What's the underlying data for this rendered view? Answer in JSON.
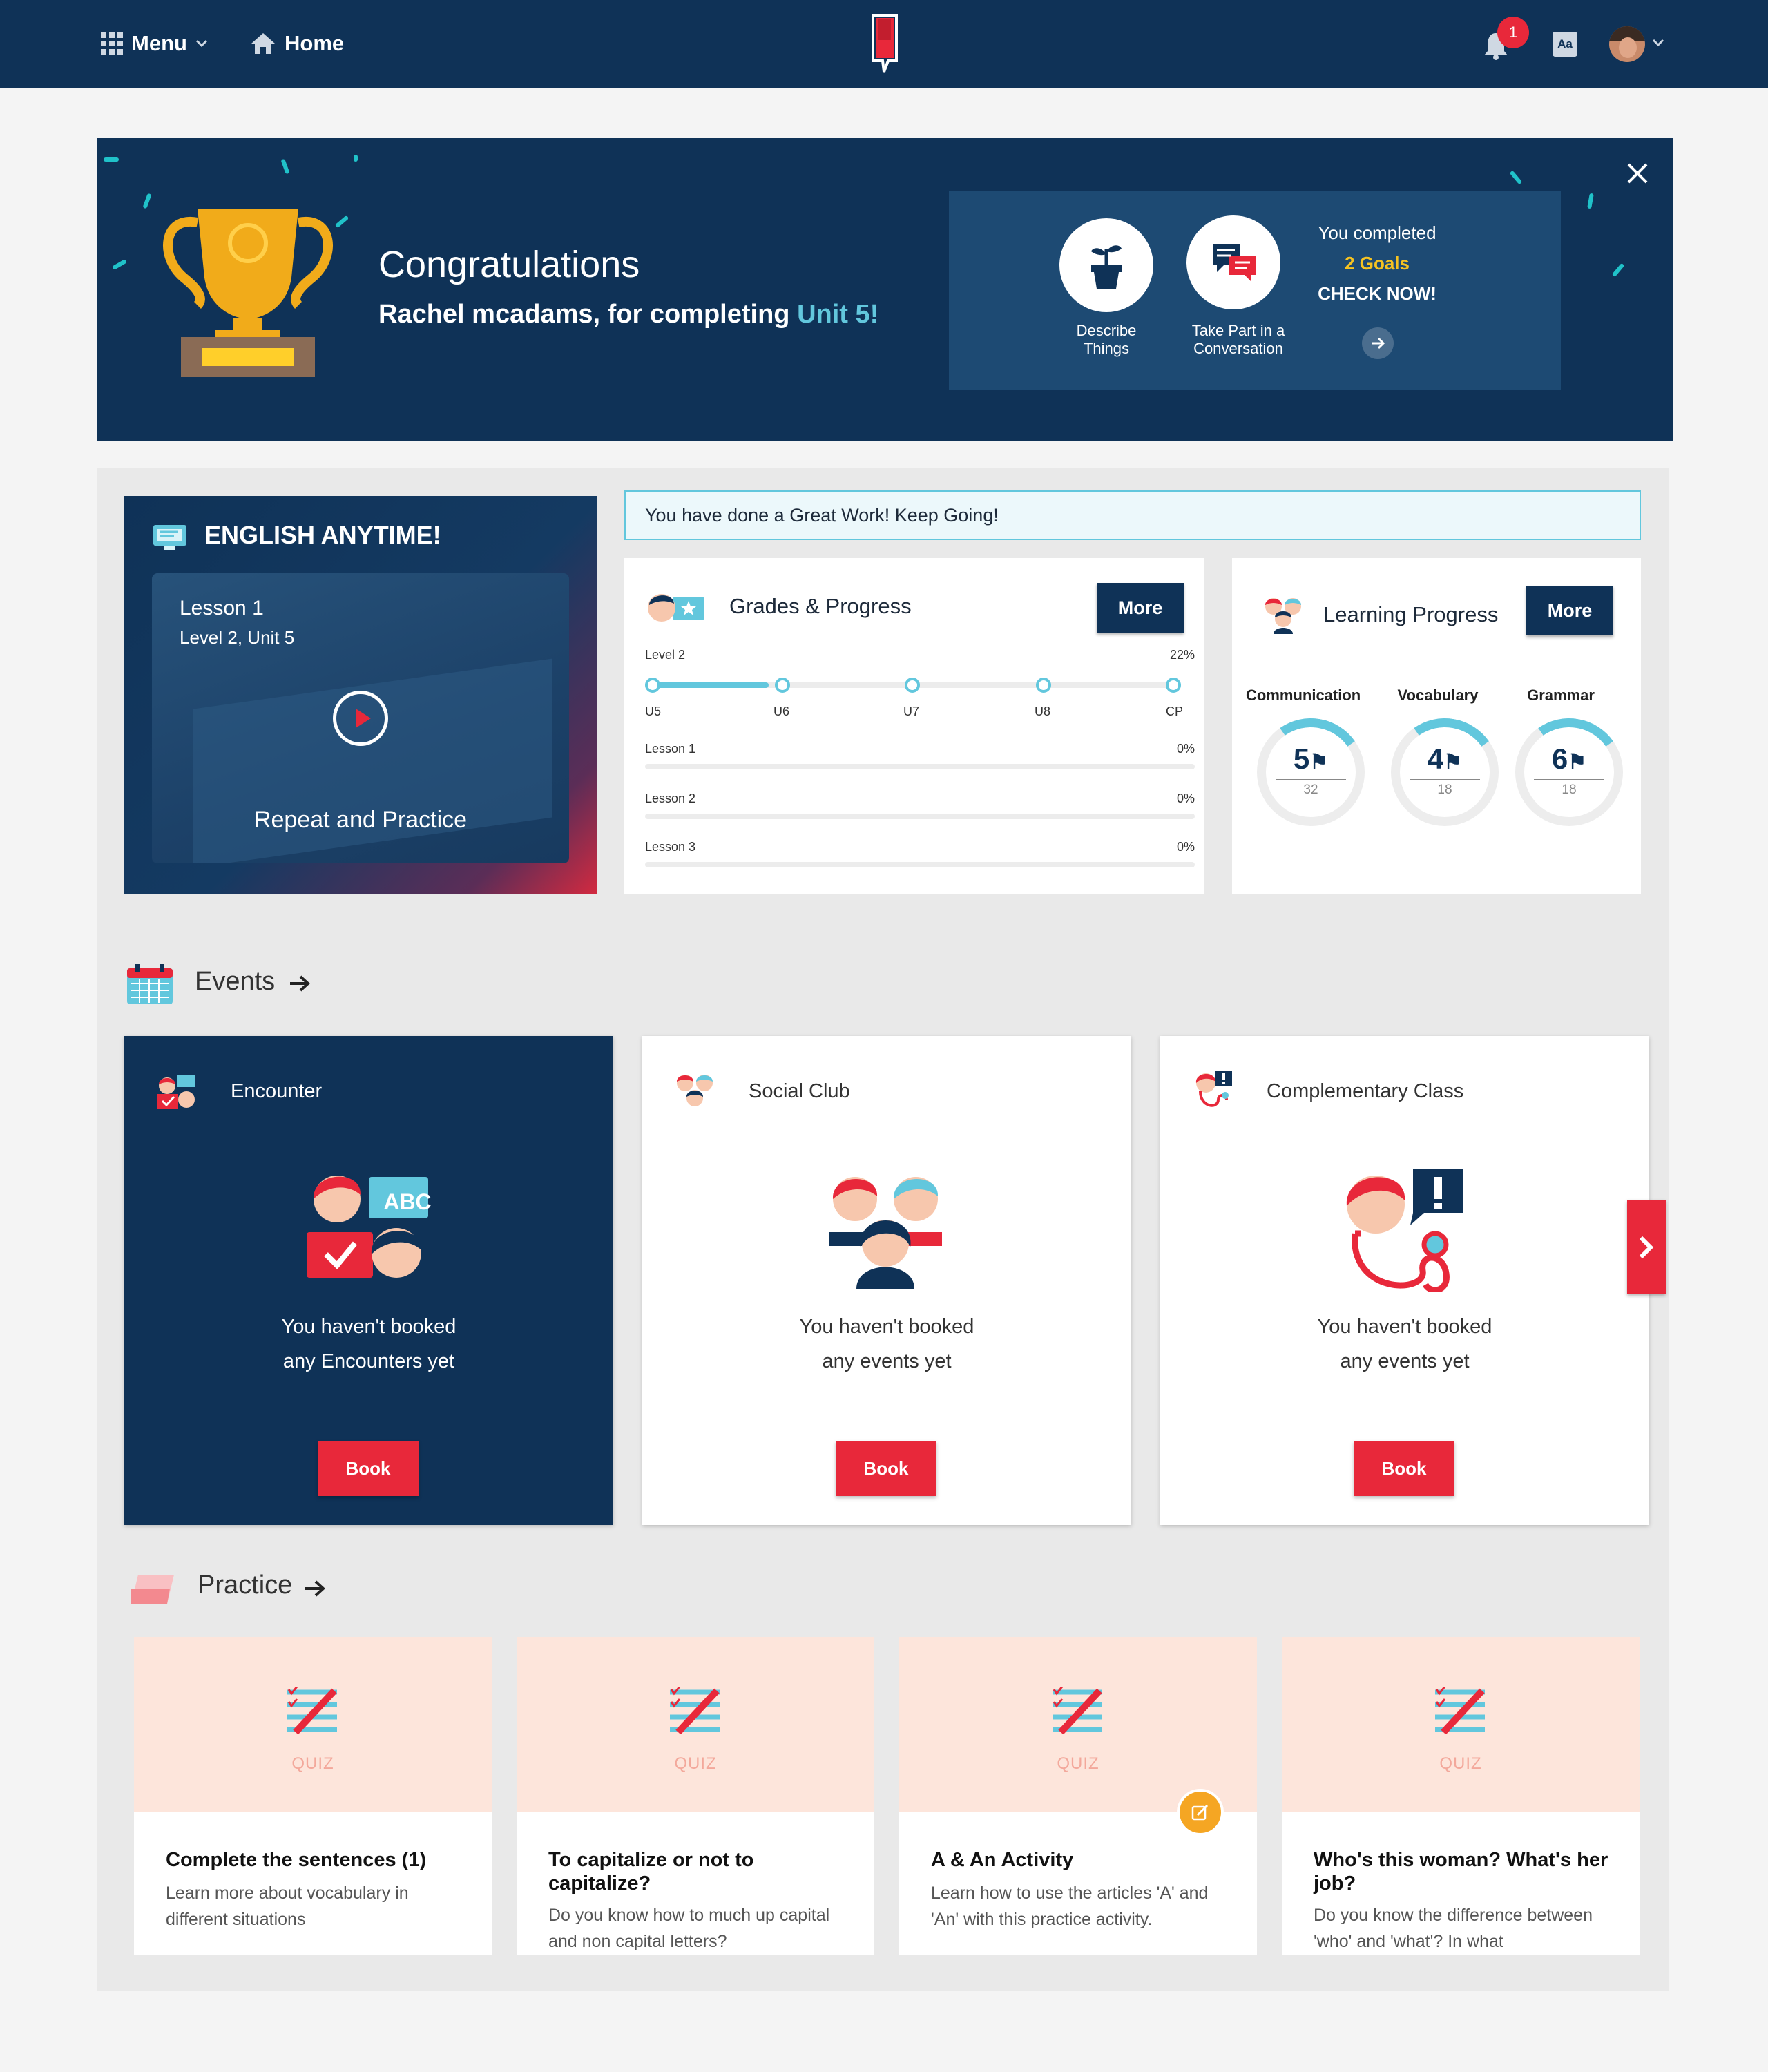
{
  "nav": {
    "menu": "Menu",
    "home": "Home",
    "notifications": "1",
    "font_icon": "Aa"
  },
  "banner": {
    "title": "Congratulations",
    "message_prefix": "Rachel mcadams, for completing ",
    "message_unit": "Unit 5!",
    "goal1": "Describe Things",
    "goal2": "Take Part in a Conversation",
    "completed": "You completed",
    "goals": "2 Goals",
    "check": "CHECK NOW!"
  },
  "anytime": {
    "title": "ENGLISH ANYTIME!",
    "lesson": "Lesson 1",
    "level": "Level 2, Unit 5",
    "action": "Repeat and Practice"
  },
  "notice": "You have done a Great Work! Keep Going!",
  "grades": {
    "title": "Grades & Progress",
    "more": "More",
    "level": "Level 2",
    "percent": "22%",
    "progress": 0.22,
    "units": [
      "U5",
      "U6",
      "U7",
      "U8",
      "CP"
    ],
    "lessons": [
      {
        "label": "Lesson 1",
        "value": "0%"
      },
      {
        "label": "Lesson 2",
        "value": "0%"
      },
      {
        "label": "Lesson 3",
        "value": "0%"
      }
    ]
  },
  "learning": {
    "title": "Learning Progress",
    "more": "More",
    "skills": [
      {
        "name": "Communication",
        "value": "5",
        "total": "32"
      },
      {
        "name": "Vocabulary",
        "value": "4",
        "total": "18"
      },
      {
        "name": "Grammar",
        "value": "6",
        "total": "18"
      }
    ]
  },
  "events": {
    "title": "Events",
    "cards": [
      {
        "title": "Encounter",
        "line1": "You haven't booked",
        "line2": "any Encounters yet",
        "button": "Book"
      },
      {
        "title": "Social Club",
        "line1": "You haven't booked",
        "line2": "any events yet",
        "button": "Book"
      },
      {
        "title": "Complementary Class",
        "line1": "You haven't booked",
        "line2": "any events yet",
        "button": "Book"
      }
    ],
    "badge_abc": "ABC",
    "badge_excl": "!"
  },
  "practice": {
    "title": "Practice",
    "cards": [
      {
        "type": "QUIZ",
        "title": "Complete the sentences (1)",
        "desc": "Learn more about vocabulary in different situations"
      },
      {
        "type": "QUIZ",
        "title": "To capitalize or not to capitalize?",
        "desc": "Do you know how to much up capital and non capital letters?"
      },
      {
        "type": "QUIZ",
        "title": "A & An Activity",
        "desc": "Learn how to use the articles 'A' and 'An' with this practice activity."
      },
      {
        "type": "QUIZ",
        "title": "Who's this woman? What's her job?",
        "desc": "Do you know the difference between 'who' and 'what'? In what"
      }
    ]
  },
  "colors": {
    "navy": "#0f3257",
    "red": "#e8283a",
    "teal": "#62c7dd",
    "yellow": "#f6c321"
  }
}
